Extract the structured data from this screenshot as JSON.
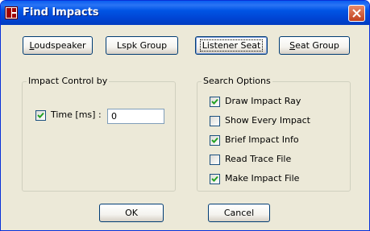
{
  "window": {
    "title": "Find Impacts",
    "icon": "app-logo-icon",
    "close_icon": "close-x-icon"
  },
  "top_buttons": [
    {
      "label": "Loudspeaker",
      "mnemonic": "L"
    },
    {
      "label": "Lspk Group",
      "mnemonic": ""
    },
    {
      "label": "Listener Seat",
      "mnemonic": "",
      "focused": true
    },
    {
      "label": "Seat Group",
      "mnemonic": "S"
    }
  ],
  "impact_control": {
    "legend": "Impact Control by",
    "time_label": "Time [ms] :",
    "time_checked": true,
    "time_value": "0"
  },
  "search_options": {
    "legend": "Search Options",
    "items": [
      {
        "label": "Draw Impact Ray",
        "checked": true
      },
      {
        "label": "Show Every Impact",
        "checked": false
      },
      {
        "label": "Brief Impact Info",
        "checked": true
      },
      {
        "label": "Read Trace File",
        "checked": false
      },
      {
        "label": "Make Impact File",
        "checked": true
      }
    ]
  },
  "footer": {
    "ok_label": "OK",
    "cancel_label": "Cancel"
  },
  "colors": {
    "titlebar": "#0055e5",
    "dialog_bg": "#ece9d8",
    "check_mark": "#21a121",
    "close_button": "#c0401e"
  }
}
